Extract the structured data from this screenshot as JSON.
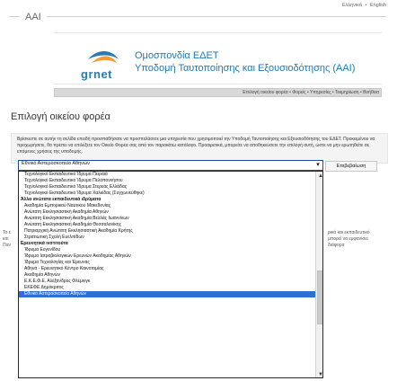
{
  "lang": {
    "el": "Ελληνικά",
    "sep": "•",
    "en": "English"
  },
  "brand": {
    "aai": "AAI",
    "logo_text": "grnet"
  },
  "header": {
    "line1": "Ομοσπονδία ΕΔΕΤ",
    "line2": "Υποδομή Ταυτοποίησης και Εξουσιοδότησης (AAI)"
  },
  "nav": {
    "text": "Επιλογή οικείου φορέα • Φορείς • Υπηρεσίες • Τεκμηρίωση • Βοήθεια"
  },
  "page": {
    "title": "Επιλογή οικείου φορέα"
  },
  "description": "Βρίσκεστε σε αυτήν τη σελίδα επειδή προσπαθήσατε να προσπελάσετε μια υπηρεσία που χρησιμοποιεί την Υποδομή Ταυτοποίησης και Εξουσιοδότησης του ΕΔΕΤ. Προκειμένου να προχωρήσετε, θα πρέπει να επιλέξετε τον Οικείο Φορέα σας από τον παρακάτω κατάλογο. Προαιρετικά, μπορείτε να αποθηκεύσετε την επιλογή αυτή, ώστε να μην ερωτηθείτε σε επόμενες χρήσεις της υποδομής.",
  "select": {
    "value": "Εθνικό Αστεροσκοπείο Αθηνών",
    "caret": "▾"
  },
  "confirm_button": "Επιβεβαίωση",
  "behind_text": {
    "left1": "Το ε",
    "left2": "και",
    "left3": "Παν",
    "right1": "ρικό και εκπαιδευτικό",
    "right2": "μπορεί να εμφανίσει διάφορα"
  },
  "options": [
    {
      "label": "Τεχνολογικό Εκπαιδευτικό Ίδρυμα Πειραιά",
      "type": "ind"
    },
    {
      "label": "Τεχνολογικό Εκπαιδευτικό Ίδρυμα Πελοποννήσου",
      "type": "ind"
    },
    {
      "label": "Τεχνολογικό Εκπαιδευτικό Ίδρυμα Στερεάς Ελλάδας",
      "type": "ind"
    },
    {
      "label": "Τεχνολογικό Εκπαιδευτικό Ίδρυμα Χαλκίδας (Συγχωνεύθηκε)",
      "type": "ind"
    },
    {
      "label": "Άλλα ανώτατα εκπαιδευτικά ιδρύματα",
      "type": "group"
    },
    {
      "label": "Ακαδημία Εμπορικού Ναυτικού Μακεδονίας",
      "type": "ind"
    },
    {
      "label": "Ανώτατη Εκκλησιαστική Ακαδημία Αθηνών",
      "type": "ind"
    },
    {
      "label": "Ανώτατη Εκκλησιαστική Ακαδημία Βελλάς Ιωαννίνων",
      "type": "ind"
    },
    {
      "label": "Ανώτατη Εκκλησιαστική Ακαδημία Θεσσαλονίκης",
      "type": "ind"
    },
    {
      "label": "Πατριαρχική Ανώτατη Εκκλησιαστική Ακαδημία Κρήτης",
      "type": "ind"
    },
    {
      "label": "Στρατιωτική Σχολή Ευελπίδων",
      "type": "ind"
    },
    {
      "label": "Ερευνητικά ινστιτούτα",
      "type": "group"
    },
    {
      "label": "Ίδρυμα Ευγενίδου",
      "type": "ind"
    },
    {
      "label": "Ίδρυμα Ιατροβιολογικών Ερευνών Ακαδημίας Αθηνών",
      "type": "ind"
    },
    {
      "label": "Ίδρυμα Τεχνολογίας και Έρευνας",
      "type": "ind"
    },
    {
      "label": "Αθηνά - Ερευνητικό Κέντρο Καινοτομίας",
      "type": "ind"
    },
    {
      "label": "Ακαδημία Αθηνών",
      "type": "ind"
    },
    {
      "label": "Ε.Κ.Ε.Φ.Ε. Αλέξανδρος Φλέμινγκ",
      "type": "ind"
    },
    {
      "label": "ΕΚΕΦΕ Δημόκριτος",
      "type": "ind"
    },
    {
      "label": "Εθνικό Αστεροσκοπείο Αθηνών",
      "type": "sel"
    }
  ],
  "colors": {
    "accent": "#1f77b4",
    "selected": "#2f6ed8"
  }
}
